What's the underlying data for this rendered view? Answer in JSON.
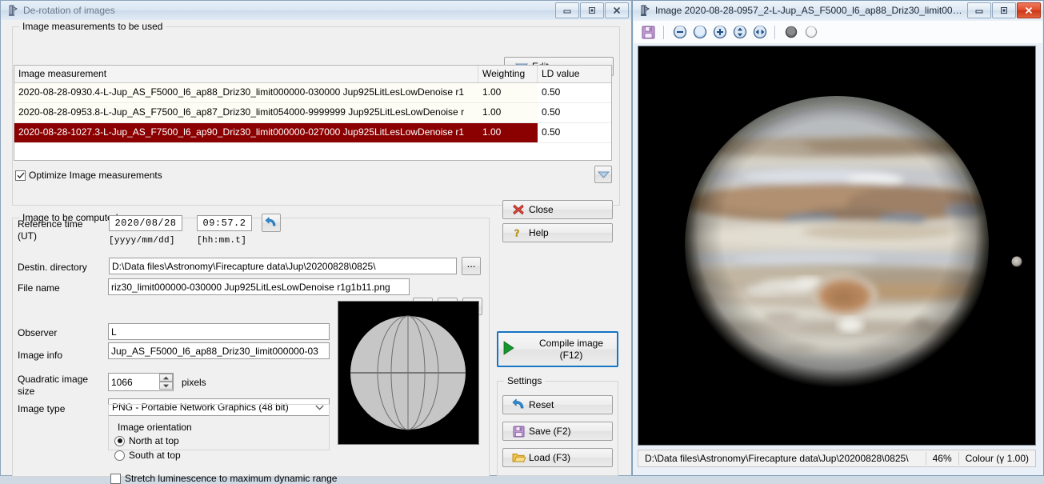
{
  "derotation_window": {
    "title": "De-rotation of images",
    "titlebar_buttons": {
      "minimize": "minimize",
      "maximize": "maximize",
      "close": "close"
    },
    "measurements_group": {
      "legend": "Image measurements to be used",
      "edit_button": "Edit",
      "columns": [
        "Image measurement",
        "Weighting",
        "LD value"
      ],
      "rows": [
        {
          "measurement": "2020-08-28-0930.4-L-Jup_AS_F5000_l6_ap88_Driz30_limit000000-030000 Jup925LitLesLowDenoise r1",
          "weighting": "1.00",
          "ld_value": "0.50",
          "selected": false
        },
        {
          "measurement": "2020-08-28-0953.8-L-Jup_AS_F7500_l6_ap87_Driz30_limit054000-9999999 Jup925LitLesLowDenoise r",
          "weighting": "1.00",
          "ld_value": "0.50",
          "selected": false
        },
        {
          "measurement": "2020-08-28-1027.3-L-Jup_AS_F7500_l6_ap90_Driz30_limit000000-027000 Jup925LitLesLowDenoise r1",
          "weighting": "1.00",
          "ld_value": "0.50",
          "selected": true
        }
      ],
      "optimize_checkbox": {
        "label": "Optimize Image measurements",
        "checked": true
      },
      "expand_button": "expand"
    },
    "computed_group": {
      "legend": "Image to be computed",
      "reference_time_label": "Reference time\n(UT)",
      "reference_time_label_line1": "Reference time",
      "reference_time_label_line2": "(UT)",
      "date_value": "2020/08/28",
      "time_value": "09:57.2",
      "date_format_hint": "[yyyy/mm/dd]",
      "time_format_hint": "[hh:mm.t]",
      "reset_time_button": "reset-time",
      "destin_directory_label": "Destin. directory",
      "destin_directory_value": "D:\\Data files\\Astronomy\\Firecapture data\\Jup\\20200828\\0825\\",
      "browse_button": "...",
      "file_name_label": "File name",
      "file_name_value": "riz30_limit000000-030000 Jup925LitLesLowDenoise r1g1b11.png",
      "observer_label": "Observer",
      "observer_value": "L",
      "image_info_label": "Image info",
      "image_info_value": "Jup_AS_F5000_l6_ap88_Driz30_limit000000-03",
      "quadratic_size_label_line1": "Quadratic image",
      "quadratic_size_label_line2": "size",
      "quadratic_size_value": "1066",
      "pixels_label": "pixels",
      "image_type_label": "Image type",
      "image_type_value": "PNG  - Portable Network Graphics (48 bit)",
      "orientation_group_label": "Image orientation",
      "orientation_north": "North at top",
      "orientation_south": "South at top",
      "orientation_selected": "North at top",
      "stretch_checkbox": {
        "label": "Stretch luminescence to maximum dynamic range",
        "checked": false
      }
    },
    "actions": {
      "close_button": "Close",
      "help_button": "Help",
      "compile_line1": "Compile image",
      "compile_line2": "(F12)",
      "settings_legend": "Settings",
      "reset_button": "Reset",
      "save_button": "Save (F2)",
      "load_button": "Load (F3)"
    }
  },
  "image_window": {
    "title_prefix": "Image",
    "title": "Image  2020-08-28-0957_2-L-Jup_AS_F5000_l6_ap88_Driz30_limit0000...",
    "toolbar_icons": [
      "save-icon",
      "zoom-out-icon",
      "zoom-fit-icon",
      "zoom-in-icon",
      "fit-vertical-icon",
      "fit-horizontal-icon",
      "dark-circle-icon",
      "light-circle-icon"
    ],
    "status": {
      "path": "D:\\Data files\\Astronomy\\Firecapture data\\Jup\\20200828\\0825\\",
      "zoom": "46%",
      "colour_mode": "Colour (γ 1.00)"
    },
    "photo": {
      "subject": "Jupiter",
      "features": [
        "Great Red Spot",
        "North Equatorial Belt",
        "South Equatorial Belt",
        "moon"
      ],
      "background": "#000000"
    }
  },
  "colors": {
    "selection_red": "#8b0000",
    "focus_blue": "#1675c4",
    "title_text": "#6b7b8c"
  }
}
